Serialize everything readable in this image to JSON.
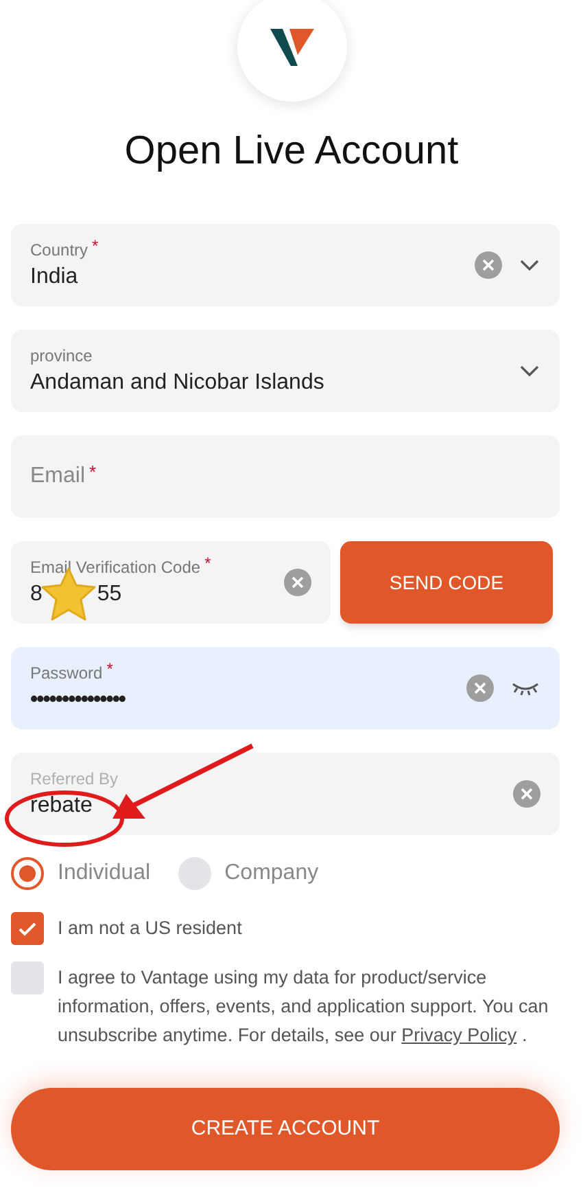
{
  "title": "Open Live Account",
  "fields": [
    {
      "kind": "select",
      "label": "Country",
      "mark": "*",
      "value": "India",
      "clearable": true,
      "highlighted": false
    },
    {
      "kind": "select",
      "label": "province",
      "value": "Andaman and Nicobar Islands",
      "clearable": false,
      "highlighted": false
    },
    {
      "kind": "text",
      "placeholder": "Email",
      "mark": "*",
      "clearable": false,
      "highlighted": false
    },
    {
      "kind": "code",
      "label": "Email Verification Code",
      "mark": "*",
      "value_start": "8",
      "value_end": "55",
      "clearable": true,
      "button": "SEND CODE",
      "highlighted": false
    },
    {
      "kind": "password",
      "label": "Password",
      "mark": "*",
      "value": "•••••••••••••••",
      "clearable": true,
      "highlighted": true
    },
    {
      "kind": "text",
      "label": "Referred By",
      "value": "rebate",
      "clearable": true,
      "highlighted": false
    }
  ],
  "account_types": [
    {
      "label": "Individual",
      "selected": true
    },
    {
      "label": "Company",
      "selected": false
    }
  ],
  "consents": [
    {
      "text": "I am not a US resident",
      "checked": true
    },
    {
      "text": "I agree to Vantage using my data for product/service information, offers, events, and application support. You can unsubscribe anytime. For details, see our",
      "link": "Privacy Policy",
      "after": ".",
      "checked": false
    }
  ],
  "submit": "CREATE ACCOUNT"
}
